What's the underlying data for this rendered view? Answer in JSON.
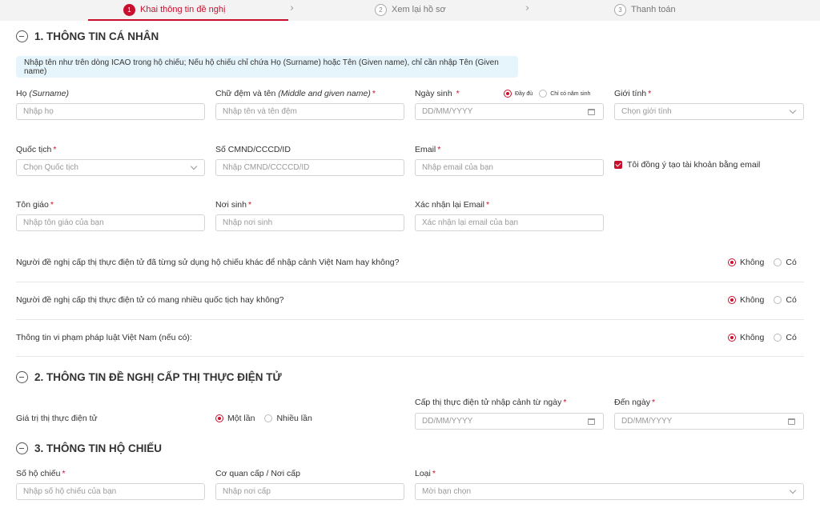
{
  "stepper": {
    "steps": [
      {
        "num": "1",
        "label": "Khai thông tin đề nghị"
      },
      {
        "num": "2",
        "label": "Xem lại hồ sơ"
      },
      {
        "num": "3",
        "label": "Thanh toán"
      }
    ]
  },
  "sections": {
    "personal": "1. THÔNG TIN CÁ NHÂN",
    "visa": "2. THÔNG TIN ĐỀ NGHỊ CẤP THỊ THỰC ĐIỆN TỬ",
    "passport": "3. THÔNG TIN HỘ CHIẾU"
  },
  "info_note": "Nhập tên như trên dòng ICAO trong hộ chiếu; Nếu hộ chiếu chỉ chứa Họ (Surname) hoặc Tên (Given name), chỉ cần nhập Tên (Given name)",
  "fields": {
    "surname": {
      "label": "Họ",
      "label_italic": "(Surname)",
      "placeholder": "Nhập họ"
    },
    "given_name": {
      "label": "Chữ đệm và tên",
      "label_italic": "(Middle and given name)",
      "placeholder": "Nhập tên và tên đệm"
    },
    "dob": {
      "label": "Ngày sinh",
      "placeholder": "DD/MM/YYYY",
      "options": [
        "Đầy đủ",
        "Chỉ có năm sinh"
      ]
    },
    "gender": {
      "label": "Giới tính",
      "placeholder": "Chọn giới tính"
    },
    "nationality": {
      "label": "Quốc tịch",
      "placeholder": "Chọn Quốc tịch"
    },
    "id_number": {
      "label": "Số CMND/CCCD/ID",
      "placeholder": "Nhập CMND/CCCCD/ID"
    },
    "email": {
      "label": "Email",
      "placeholder": "Nhập email của bạn"
    },
    "create_account": {
      "label": "Tôi đồng ý tạo tài khoản bằng email"
    },
    "religion": {
      "label": "Tôn giáo",
      "placeholder": "Nhập tôn giáo của bạn"
    },
    "birthplace": {
      "label": "Nơi sinh",
      "placeholder": "Nhập nơi sinh"
    },
    "email_confirm": {
      "label": "Xác nhận lại Email",
      "placeholder": "Xác nhận lại email của bạn"
    },
    "visa_validity": {
      "label": "Giá trị thị thực điện tử",
      "options": [
        "Một lần",
        "Nhiều lần"
      ]
    },
    "visa_from": {
      "label": "Cấp thị thực điện tử nhập cảnh từ ngày",
      "placeholder": "DD/MM/YYYY"
    },
    "visa_to": {
      "label": "Đến ngày",
      "placeholder": "DD/MM/YYYY"
    },
    "passport_no": {
      "label": "Số hộ chiếu",
      "placeholder": "Nhập số hộ chiếu của bạn"
    },
    "issuer": {
      "label": "Cơ quan cấp / Nơi cấp",
      "placeholder": "Nhập nơi cấp"
    },
    "passport_type": {
      "label": "Loại",
      "placeholder": "Mời bạn chọn"
    }
  },
  "questions": [
    {
      "text": "Người đề nghị cấp thị thực điện tử đã từng sử dụng hộ chiếu khác để nhập cảnh Việt Nam hay không?",
      "options": [
        "Không",
        "Có"
      ]
    },
    {
      "text": "Người đề nghị cấp thị thực điện tử có mang nhiều quốc tịch hay không?",
      "options": [
        "Không",
        "Có"
      ]
    },
    {
      "text": "Thông tin vi phạm pháp luật Việt Nam (nếu có):",
      "options": [
        "Không",
        "Có"
      ]
    }
  ],
  "colors": {
    "accent": "#c8102e",
    "info_bg": "#e6f5fb"
  }
}
